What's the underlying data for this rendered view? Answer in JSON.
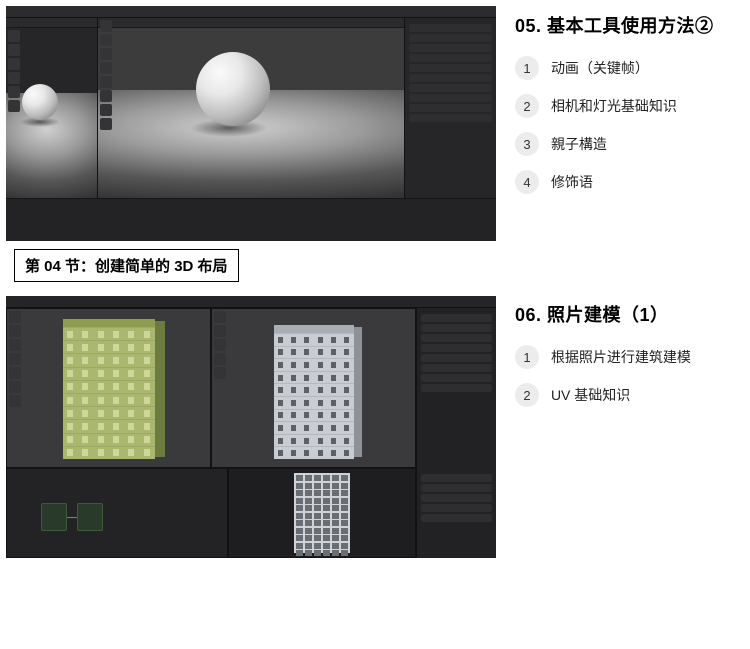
{
  "section05": {
    "title": "05. 基本工具使用方法②",
    "items": [
      {
        "num": "1",
        "label": "动画（关键帧）"
      },
      {
        "num": "2",
        "label": "相机和灯光基础知识"
      },
      {
        "num": "3",
        "label": "親子構造"
      },
      {
        "num": "4",
        "label": "修饰语"
      }
    ]
  },
  "card04": {
    "label": "第 04 节：创建简单的 3D 布局"
  },
  "section06": {
    "title": "06. 照片建模（1）",
    "items": [
      {
        "num": "1",
        "label": "根据照片进行建筑建模"
      },
      {
        "num": "2",
        "label": "UV 基础知识"
      }
    ]
  }
}
